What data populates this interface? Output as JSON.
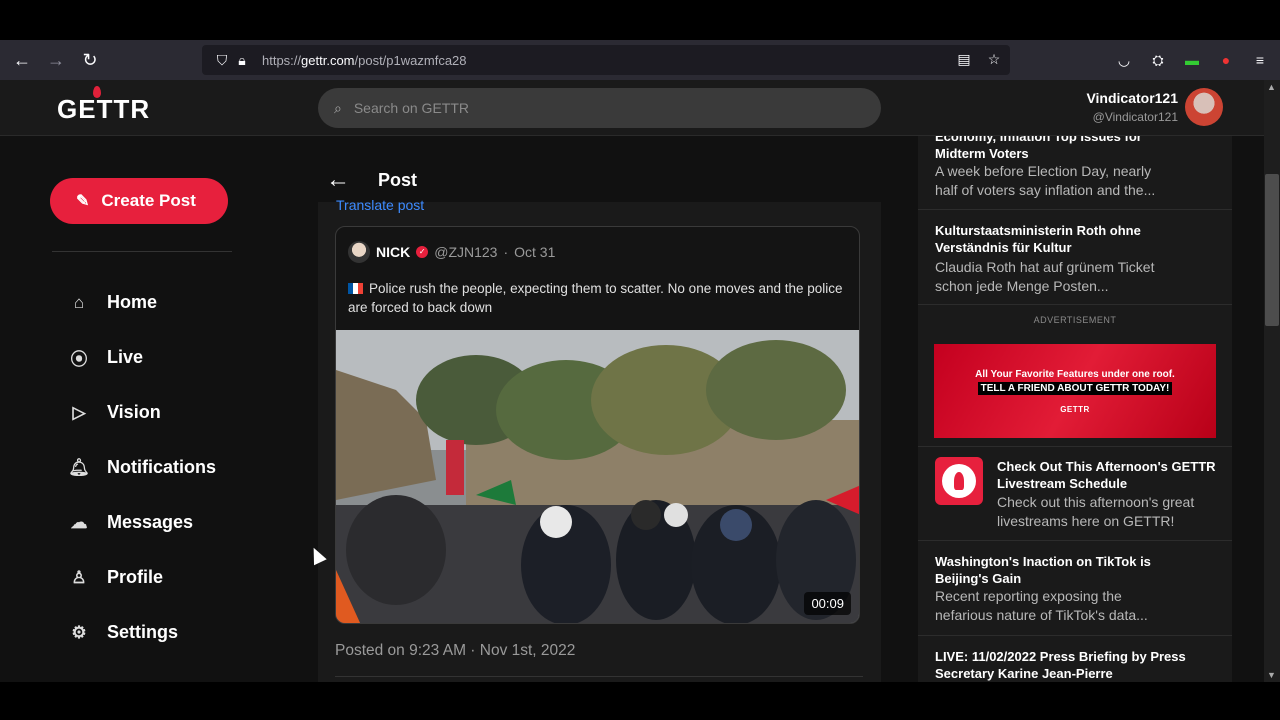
{
  "browser": {
    "url_prefix": "https://",
    "url_host": "gettr.com",
    "url_path": "/post/p1wazmfca28"
  },
  "header": {
    "logo": "GETTR",
    "search_placeholder": "Search on GETTR",
    "user_name": "Vindicator121",
    "user_handle": "@Vindicator121"
  },
  "sidebar": {
    "create_label": "Create Post",
    "items": [
      {
        "label": "Home",
        "icon": "home-icon"
      },
      {
        "label": "Live",
        "icon": "live-icon"
      },
      {
        "label": "Vision",
        "icon": "vision-icon"
      },
      {
        "label": "Notifications",
        "icon": "bell-icon"
      },
      {
        "label": "Messages",
        "icon": "messages-icon"
      },
      {
        "label": "Profile",
        "icon": "profile-icon"
      },
      {
        "label": "Settings",
        "icon": "gear-icon"
      }
    ]
  },
  "post": {
    "title": "Post",
    "translate": "Translate post",
    "quote": {
      "name": "NICK",
      "handle": "@ZJN123",
      "date": "Oct 31",
      "text": "Police rush the people, expecting them to scatter. No one moves and the police are forced to back down"
    },
    "video_duration": "00:09",
    "posted_on": "Posted on 9:23 AM · Nov 1st, 2022"
  },
  "right": {
    "news": [
      {
        "title": "Economy, Inflation Top Issues for Midterm Voters",
        "desc": "A week before Election Day, nearly half of voters say inflation and the..."
      },
      {
        "title": "Kulturstaatsministerin Roth ohne Verständnis für Kultur",
        "desc": "Claudia Roth hat auf grünem Ticket schon jede Menge Posten..."
      },
      {
        "title": "Check Out This Afternoon's GETTR Livestream Schedule",
        "desc": "Check out this afternoon's great livestreams here on GETTR!"
      },
      {
        "title": "Washington's Inaction on TikTok is Beijing's Gain",
        "desc": "Recent reporting exposing the nefarious nature of TikTok's data..."
      },
      {
        "title": "LIVE: 11/02/2022 Press Briefing by Press Secretary Karine Jean-Pierre",
        "desc": ""
      }
    ],
    "ad_label": "ADVERTISEMENT",
    "ad_line1": "All Your Favorite Features under one roof.",
    "ad_line2": "TELL A FRIEND ABOUT GETTR TODAY!",
    "ad_logo": "GETTR"
  },
  "colors": {
    "accent": "#e7203d",
    "link": "#3d8bff"
  }
}
